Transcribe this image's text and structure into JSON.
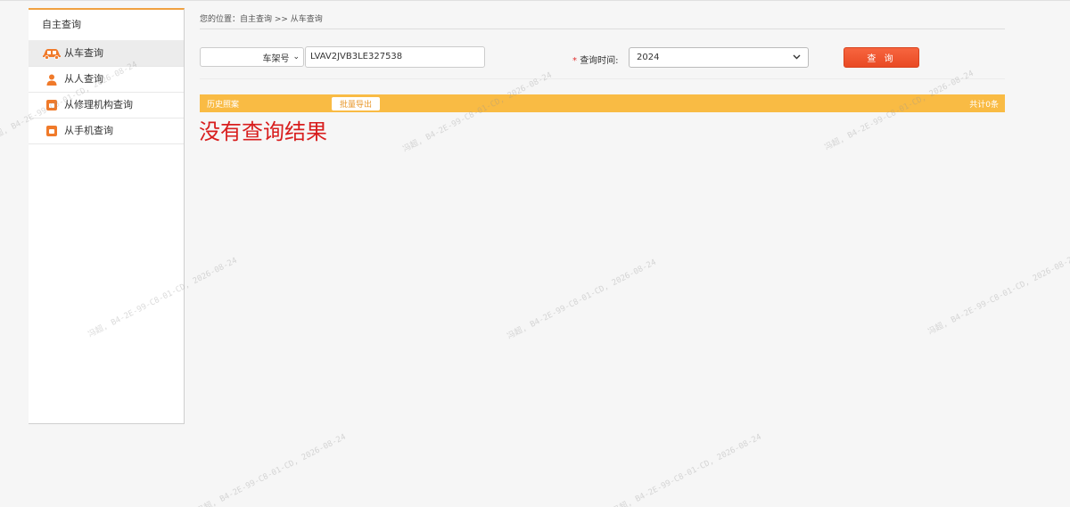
{
  "sidebar": {
    "title": "自主查询",
    "items": [
      {
        "label": "从车查询",
        "icon": "car-icon",
        "active": true
      },
      {
        "label": "从人查询",
        "icon": "person-icon",
        "active": false
      },
      {
        "label": "从修理机构查询",
        "icon": "shop-icon",
        "active": false
      },
      {
        "label": "从手机查询",
        "icon": "shop-icon",
        "active": false
      }
    ]
  },
  "breadcrumb": "您的位置：自主查询 >> 从车查询",
  "search": {
    "type_select": "车架号",
    "vin_value": "LVAV2JVB3LE327538",
    "time_required_mark": "*",
    "time_label": "查询时间:",
    "year_value": "2024",
    "query_button": "查 询"
  },
  "history": {
    "title": "历史照案",
    "export_button": "批量导出",
    "total": "共计0条"
  },
  "no_result": "没有查询结果",
  "watermark": "冯超, B4-2E-99-C8-01-CD, 2026-08-24",
  "colors": {
    "accent_orange": "#f9bb44",
    "query_red": "#ea4d27",
    "no_result_red": "#d81e1e"
  }
}
